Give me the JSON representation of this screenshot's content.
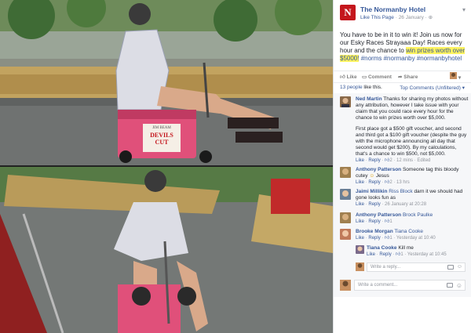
{
  "page": {
    "name": "The Normanby Hotel",
    "logo_letter": "N",
    "like_link": "Like This Page",
    "separator": "·",
    "date": "26 January ·"
  },
  "post": {
    "text_before": "You have to be in it to win it! Join us now for our Esky Races Strayaaa Day! Races every hour and the chance to ",
    "highlight": "win prizes worth over $5000!",
    "tags": " #norms #normanby #normanbyhotel"
  },
  "actions": {
    "like": "Like",
    "comment": "Comment",
    "share": "Share",
    "dropdown": "▾"
  },
  "summary": {
    "likes_count": "13 people",
    "likes_suffix": "like this.",
    "top_comments": "Top Comments (Unfiltered) ▾"
  },
  "comments": [
    {
      "author": "Ned Martin",
      "p1": "Thanks for sharing my photos without any attribution, however I take issue with your claim that you could race every hour for the chance to win prizes worth over $5,000.",
      "p2": "First place got a $500 gift voucher, and second and third got a $100 gift voucher (despite the guy with the microphone announcing all day that second would get $200). By my calculations, that's a chance to win $500, not $5,000.",
      "like": "Like",
      "reply": "Reply",
      "reactions": "2",
      "time": "12 mins",
      "edited": "Edited"
    },
    {
      "author": "Anthony Patterson",
      "text": "Someone tag this bloody cutey",
      "emoji": "☺",
      "tail": "Jesus",
      "like": "Like",
      "reply": "Reply",
      "reactions": "2",
      "time": "13 hrs"
    },
    {
      "author": "Jaimi Millikin",
      "mention": "Riss Block",
      "text": "darn it we should had gone looks fun as",
      "like": "Like",
      "reply": "Reply",
      "time": "26 January at 20:28"
    },
    {
      "author": "Anthony Patterson",
      "mention": "Brock Paulke",
      "like": "Like",
      "reply": "Reply",
      "reactions": "1"
    },
    {
      "author": "Brooke Morgan",
      "mention": "Tiana Cooke",
      "like": "Like",
      "reply": "Reply",
      "reactions": "1",
      "time": "Yesterday at 10:40"
    },
    {
      "author": "Tiana Cooke",
      "text": "Kill me",
      "like": "Like",
      "reply": "Reply",
      "reactions": "1",
      "time": "Yesterday at 10:45"
    }
  ],
  "reply_placeholder": "Write a reply...",
  "comment_placeholder": "Write a comment...",
  "cooler_brand_top": "JIM BEAM",
  "cooler_brand": "DEVILS CUT",
  "colors": {
    "link": "#365899",
    "highlight": "#fff35f",
    "brand": "#c4161c",
    "cooler": "#e0507a"
  }
}
